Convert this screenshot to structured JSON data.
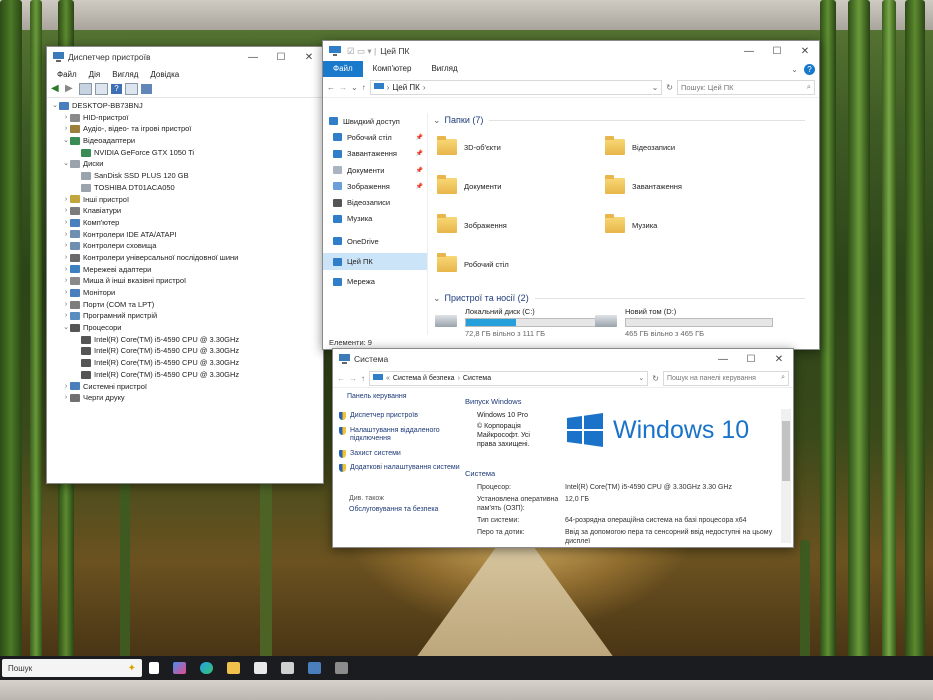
{
  "device_manager": {
    "title": "Диспетчер пристроїв",
    "menu": [
      "Файл",
      "Дія",
      "Вигляд",
      "Довідка"
    ],
    "tree": [
      {
        "label": "DESKTOP-BB73BNJ",
        "level": 0,
        "chev": "⌄",
        "icon": "computer-icon"
      },
      {
        "label": "HID-пристрої",
        "level": 1,
        "chev": "›",
        "icon": "hid-icon"
      },
      {
        "label": "Аудіо-, відео- та ігрові пристрої",
        "level": 1,
        "chev": "›",
        "icon": "audio-icon"
      },
      {
        "label": "Відеоадаптери",
        "level": 1,
        "chev": "⌄",
        "icon": "display-adapter-icon"
      },
      {
        "label": "NVIDIA GeForce GTX 1050 Ti",
        "level": 2,
        "chev": "",
        "icon": "display-adapter-icon"
      },
      {
        "label": "Диски",
        "level": 1,
        "chev": "⌄",
        "icon": "disk-icon"
      },
      {
        "label": "SanDisk SSD PLUS 120 GB",
        "level": 2,
        "chev": "",
        "icon": "disk-icon"
      },
      {
        "label": "TOSHIBA DT01ACA050",
        "level": 2,
        "chev": "",
        "icon": "disk-icon"
      },
      {
        "label": "Інші пристрої",
        "level": 1,
        "chev": "›",
        "icon": "other-device-icon"
      },
      {
        "label": "Клавіатури",
        "level": 1,
        "chev": "›",
        "icon": "keyboard-icon"
      },
      {
        "label": "Комп'ютер",
        "level": 1,
        "chev": "›",
        "icon": "computer-icon"
      },
      {
        "label": "Контролери IDE ATA/ATAPI",
        "level": 1,
        "chev": "›",
        "icon": "controller-icon"
      },
      {
        "label": "Контролери сховища",
        "level": 1,
        "chev": "›",
        "icon": "controller-icon"
      },
      {
        "label": "Контролери універсальної послідовної шини",
        "level": 1,
        "chev": "›",
        "icon": "usb-icon"
      },
      {
        "label": "Мережеві адаптери",
        "level": 1,
        "chev": "›",
        "icon": "network-icon"
      },
      {
        "label": "Миша й інші вказівні пристрої",
        "level": 1,
        "chev": "›",
        "icon": "mouse-icon"
      },
      {
        "label": "Монітори",
        "level": 1,
        "chev": "›",
        "icon": "monitor-icon"
      },
      {
        "label": "Порти (COM та LPT)",
        "level": 1,
        "chev": "›",
        "icon": "port-icon"
      },
      {
        "label": "Програмний пристрій",
        "level": 1,
        "chev": "›",
        "icon": "software-device-icon"
      },
      {
        "label": "Процесори",
        "level": 1,
        "chev": "⌄",
        "icon": "cpu-icon"
      },
      {
        "label": "Intel(R) Core(TM) i5-4590 CPU @ 3.30GHz",
        "level": 2,
        "chev": "",
        "icon": "cpu-icon"
      },
      {
        "label": "Intel(R) Core(TM) i5-4590 CPU @ 3.30GHz",
        "level": 2,
        "chev": "",
        "icon": "cpu-icon"
      },
      {
        "label": "Intel(R) Core(TM) i5-4590 CPU @ 3.30GHz",
        "level": 2,
        "chev": "",
        "icon": "cpu-icon"
      },
      {
        "label": "Intel(R) Core(TM) i5-4590 CPU @ 3.30GHz",
        "level": 2,
        "chev": "",
        "icon": "cpu-icon"
      },
      {
        "label": "Системні пристрої",
        "level": 1,
        "chev": "›",
        "icon": "system-device-icon"
      },
      {
        "label": "Черги друку",
        "level": 1,
        "chev": "›",
        "icon": "printer-icon"
      }
    ]
  },
  "explorer": {
    "title": "Цей ПК",
    "ribbon_tabs": [
      "Файл",
      "Комп'ютер",
      "Вигляд"
    ],
    "address": "Цей ПК",
    "search_placeholder": "Пошук: Цей ПК",
    "nav": [
      {
        "label": "Швидкий доступ",
        "pinned": false,
        "selected": false,
        "icon": "star-icon"
      },
      {
        "label": "Робочий стіл",
        "pinned": true,
        "selected": false,
        "icon": "desktop-icon"
      },
      {
        "label": "Завантаження",
        "pinned": true,
        "selected": false,
        "icon": "download-icon"
      },
      {
        "label": "Документи",
        "pinned": true,
        "selected": false,
        "icon": "documents-icon"
      },
      {
        "label": "Зображення",
        "pinned": true,
        "selected": false,
        "icon": "pictures-icon"
      },
      {
        "label": "Відеозаписи",
        "pinned": false,
        "selected": false,
        "icon": "videos-icon"
      },
      {
        "label": "Музика",
        "pinned": false,
        "selected": false,
        "icon": "music-icon"
      },
      {
        "label": "OneDrive",
        "pinned": false,
        "selected": false,
        "icon": "cloud-icon"
      },
      {
        "label": "Цей ПК",
        "pinned": false,
        "selected": true,
        "icon": "computer-icon"
      },
      {
        "label": "Мережа",
        "pinned": false,
        "selected": false,
        "icon": "network-icon"
      }
    ],
    "folders_header": "Папки (7)",
    "folders": [
      "3D-об'єкти",
      "Відеозаписи",
      "Документи",
      "Завантаження",
      "Зображення",
      "Музика",
      "Робочий стіл"
    ],
    "devices_header": "Пристрої та носії (2)",
    "drives": [
      {
        "name": "Локальний диск (C:)",
        "free": "72,8 ГБ вільно з 111 ГБ",
        "used_fraction": 0.34
      },
      {
        "name": "Новий том (D:)",
        "free": "465 ГБ вільно з 465 ГБ",
        "used_fraction": 0.0
      }
    ],
    "status": "Елементи: 9"
  },
  "system": {
    "title": "Система",
    "breadcrumb": [
      "Система й безпека",
      "Система"
    ],
    "search_placeholder": "Пошук на панелі керування",
    "left_links": {
      "home": "Панель керування",
      "device_manager": "Диспетчер пристроїв",
      "remote": "Налаштування віддаленого підключення",
      "protection": "Захист системи",
      "advanced": "Додаткові налаштування системи",
      "see_also": "Див. також",
      "security": "Обслуговування та безпека"
    },
    "edition_header": "Випуск Windows",
    "edition": "Windows 10 Pro",
    "copyright": "© Корпорація Майкрософт. Усі права захищені.",
    "logo_text": "Windows 10",
    "system_header": "Система",
    "rows": [
      {
        "k": "Процесор:",
        "v": "Intel(R) Core(TM) i5-4590 CPU @ 3.30GHz   3.30 GHz"
      },
      {
        "k": "Установлена оперативна пам'ять (ОЗП):",
        "v": "12,0 ГБ"
      },
      {
        "k": "Тип системи:",
        "v": "64-розрядна операційна система на базі процесора x64"
      },
      {
        "k": "Перо та дотик:",
        "v": "Ввід за допомогою пера та сенсорний ввід недоступні на цьому дисплеї"
      }
    ]
  },
  "taskbar": {
    "search_label": "Пошук"
  },
  "colors": {
    "accent": "#1979ca",
    "progress": "#26a0da",
    "windows_logo": "#1a73c9"
  }
}
